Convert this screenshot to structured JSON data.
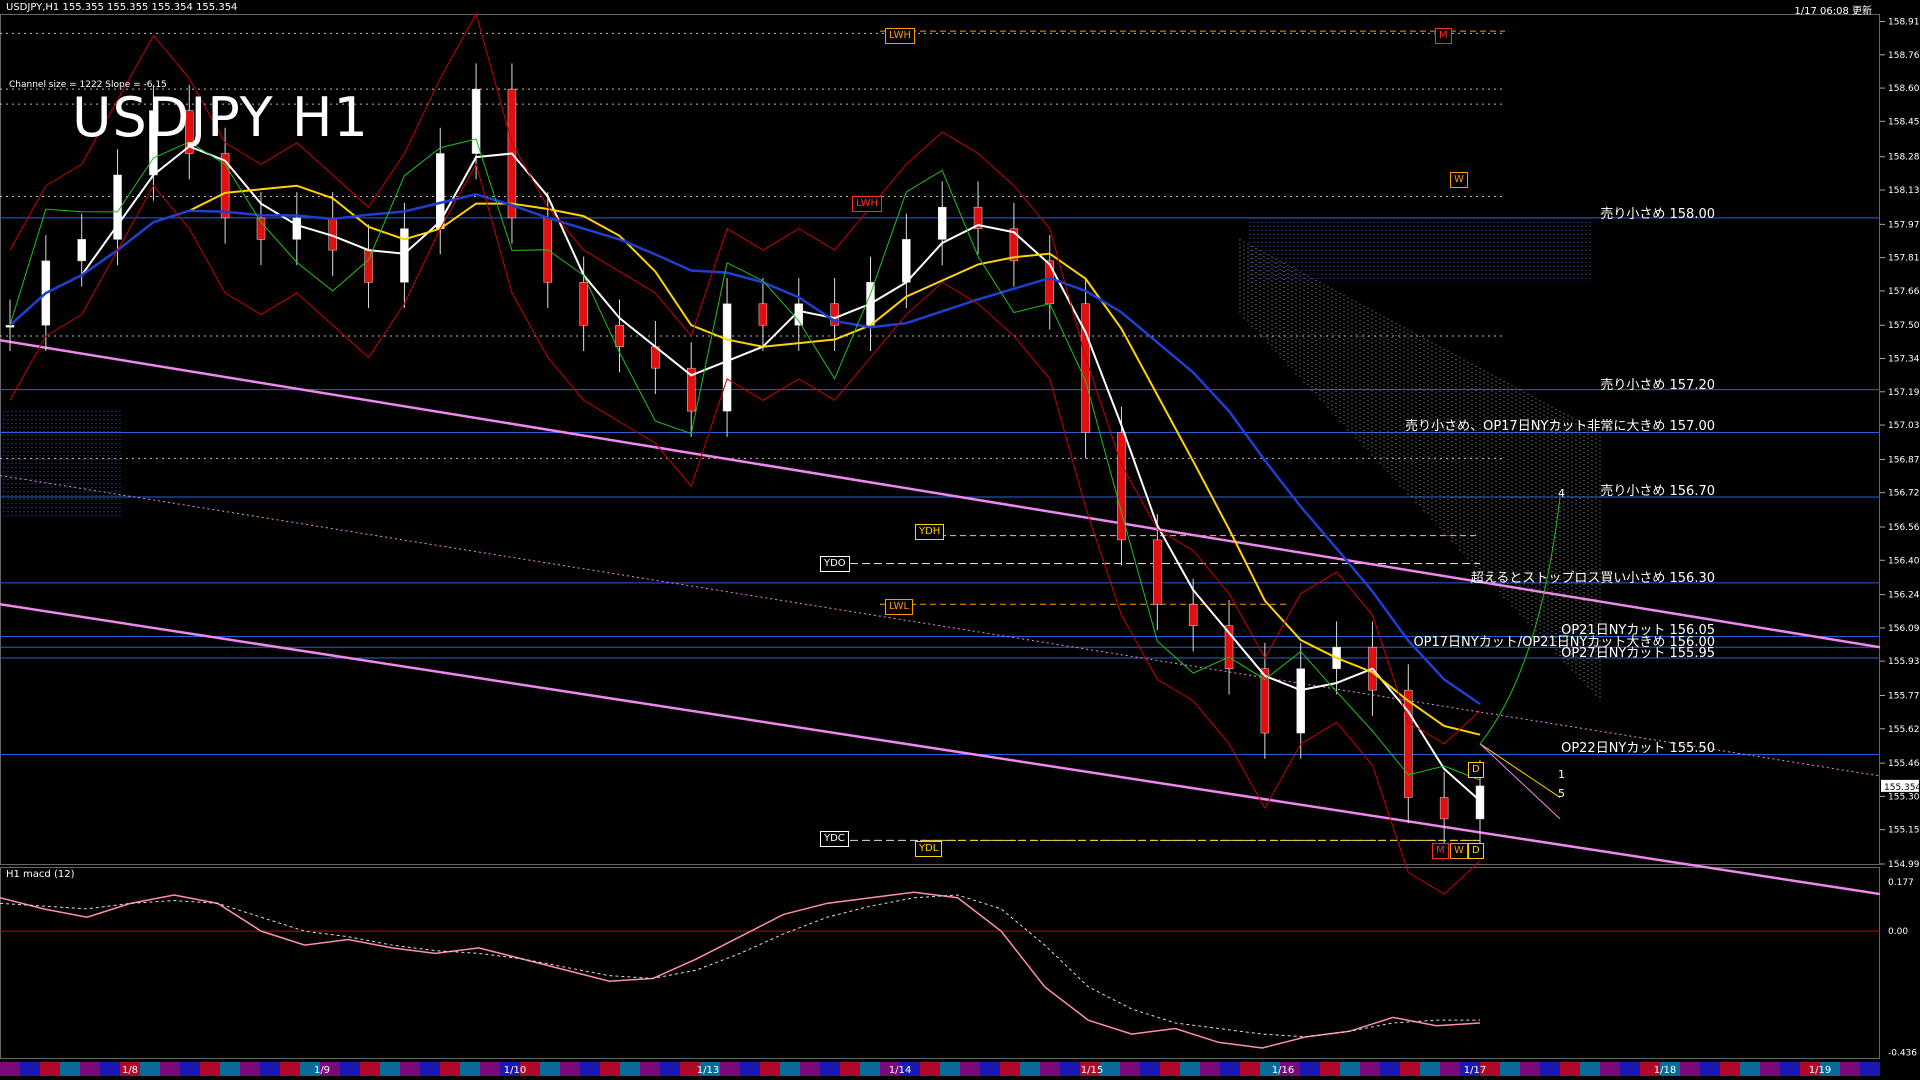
{
  "header": {
    "symbol_info": "USDJPY,H1  155.355 155.355 155.354 155.354",
    "datetime": "1/17 06:08 更新"
  },
  "overlay": {
    "title": "USDJPY H1",
    "channel_info": "Channel size = 1222 Slope = -6.15",
    "macd_title": "H1  macd (12)"
  },
  "level_labels": [
    {
      "text": "売り小さめ 158.00",
      "price": 157.995
    },
    {
      "text": "売り小さめ 157.20",
      "price": 157.2
    },
    {
      "text": "売り小さめ、OP17日NYカット非常に大きめ 157.00",
      "price": 157.005
    },
    {
      "text": "売り小さめ 156.70",
      "price": 156.705
    },
    {
      "text": "超えるとストップロス買い小さめ 156.30",
      "price": 156.3
    },
    {
      "text": "OP21日NYカット 156.05",
      "price": 156.055
    },
    {
      "text": "OP17日NYカット/OP21日NYカット大きめ 156.00",
      "price": 156.0
    },
    {
      "text": "OP27日NYカット 155.95",
      "price": 155.95
    },
    {
      "text": "OP22日NYカット 155.50",
      "price": 155.505
    }
  ],
  "markers": [
    {
      "text": "LWH",
      "style": "orange"
    },
    {
      "text": "M",
      "style": "red"
    },
    {
      "text": "LWH",
      "style": "red"
    },
    {
      "text": "W",
      "style": "orange"
    },
    {
      "text": "YDH",
      "style": "yellow"
    },
    {
      "text": "YDO",
      "style": "white"
    },
    {
      "text": "LWL",
      "style": "orange"
    },
    {
      "text": "YDC",
      "style": "white"
    },
    {
      "text": "YDL",
      "style": "yellow"
    },
    {
      "text": "D",
      "style": "yellow"
    },
    {
      "text": "M",
      "style": "red"
    },
    {
      "text": "W",
      "style": "orange"
    },
    {
      "text": "D",
      "style": "yellow"
    }
  ],
  "wave_labels": [
    "4",
    "1",
    "5"
  ],
  "chart_data": [
    {
      "type": "line",
      "name": "price",
      "price_axis_ticks": [
        158.915,
        158.76,
        158.605,
        158.45,
        158.285,
        158.13,
        157.97,
        157.815,
        157.66,
        157.5,
        157.345,
        157.19,
        157.035,
        156.875,
        156.72,
        156.56,
        156.405,
        156.245,
        156.09,
        155.935,
        155.775,
        155.62,
        155.46,
        155.305,
        155.15,
        154.99
      ],
      "current_price": "155.354",
      "ylim": [
        154.99,
        158.95
      ],
      "x_ticks": [
        "1/8",
        "1/9",
        "1/10",
        "1/13",
        "1/14",
        "1/15",
        "1/16",
        "1/17",
        "1/18",
        "1/19"
      ],
      "close_approx": [
        157.5,
        157.8,
        157.9,
        158.2,
        158.5,
        158.3,
        158.0,
        157.9,
        158.0,
        157.85,
        157.7,
        157.95,
        158.3,
        158.6,
        158.0,
        157.7,
        157.5,
        157.4,
        157.3,
        157.1,
        157.6,
        157.5,
        157.6,
        157.5,
        157.7,
        157.9,
        158.05,
        157.95,
        157.8,
        157.6,
        157.0,
        156.5,
        156.2,
        156.1,
        155.9,
        155.6,
        155.9,
        156.0,
        155.8,
        155.3,
        155.2,
        155.354
      ],
      "horizontal_levels": [
        158.0,
        157.2,
        157.0,
        156.7,
        156.3,
        156.05,
        156.0,
        155.95,
        155.5
      ]
    },
    {
      "type": "line",
      "name": "macd",
      "axis_ticks": [
        "0.177",
        "0.00",
        "-0.436"
      ],
      "ylim": [
        -0.436,
        0.177
      ],
      "macd_approx": [
        0.12,
        0.08,
        0.05,
        0.1,
        0.13,
        0.1,
        0.0,
        -0.05,
        -0.03,
        -0.06,
        -0.08,
        -0.06,
        -0.1,
        -0.14,
        -0.18,
        -0.17,
        -0.1,
        -0.02,
        0.06,
        0.1,
        0.12,
        0.14,
        0.12,
        0.0,
        -0.2,
        -0.32,
        -0.37,
        -0.35,
        -0.4,
        -0.42,
        -0.38,
        -0.36,
        -0.31,
        -0.34,
        -0.33
      ],
      "signal_approx": [
        0.1,
        0.09,
        0.08,
        0.1,
        0.11,
        0.1,
        0.05,
        0.0,
        -0.02,
        -0.05,
        -0.07,
        -0.08,
        -0.1,
        -0.13,
        -0.16,
        -0.17,
        -0.14,
        -0.08,
        -0.01,
        0.05,
        0.09,
        0.12,
        0.13,
        0.08,
        -0.05,
        -0.2,
        -0.28,
        -0.33,
        -0.35,
        -0.37,
        -0.38,
        -0.36,
        -0.33,
        -0.32,
        -0.32
      ]
    }
  ]
}
